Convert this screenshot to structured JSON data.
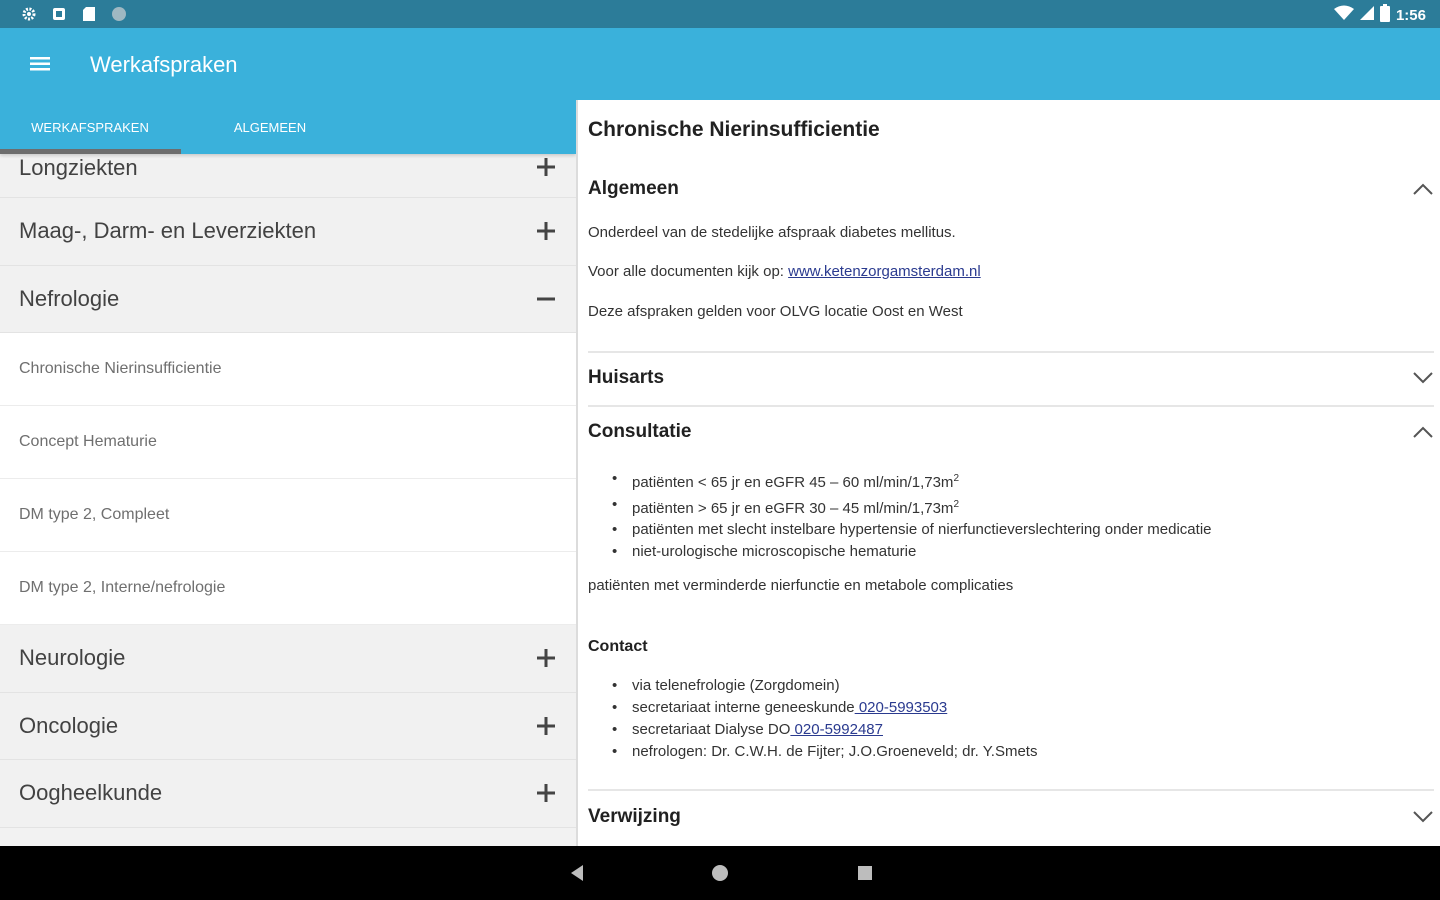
{
  "status_bar": {
    "time": "1:56",
    "left_icons": [
      "settings-icon",
      "notification-icon",
      "sd-card-icon",
      "circle-icon"
    ],
    "right_icons": [
      "wifi-icon",
      "signal-icon",
      "battery-icon"
    ]
  },
  "app_bar": {
    "title": "Werkafspraken",
    "menu_icon": "hamburger-menu-icon",
    "color": "#3ab1db"
  },
  "tabs": [
    {
      "label": "WERKAFSPRAKEN",
      "selected": true
    },
    {
      "label": "ALGEMEEN",
      "selected": false
    }
  ],
  "categories": [
    {
      "label": "Longziekten",
      "expanded": false
    },
    {
      "label": "Maag-, Darm- en Leverziekten",
      "expanded": false
    },
    {
      "label": "Nefrologie",
      "expanded": true,
      "items": [
        "Chronische Nierinsufficientie",
        "Concept Hematurie",
        "DM type 2, Compleet",
        "DM type 2, Interne/nefrologie"
      ]
    },
    {
      "label": "Neurologie",
      "expanded": false
    },
    {
      "label": "Oncologie",
      "expanded": false
    },
    {
      "label": "Oogheelkunde",
      "expanded": false
    }
  ],
  "detail": {
    "title": "Chronische Nierinsufficientie",
    "sections": {
      "algemeen": {
        "title": "Algemeen",
        "expanded": true,
        "line1": "Onderdeel van de stedelijke afspraak diabetes mellitus.",
        "line2_prefix": "Voor alle documenten kijk op: ",
        "line2_link": "www.ketenzorgamsterdam.nl",
        "line3": "Deze afspraken gelden voor OLVG locatie Oost en West"
      },
      "huisarts": {
        "title": "Huisarts",
        "expanded": false
      },
      "consultatie": {
        "title": "Consultatie",
        "expanded": true,
        "bullets": [
          {
            "text": "patiënten < 65 jr en eGFR 45 – 60 ml/min/1,73m",
            "sup": "2"
          },
          {
            "text": "patiënten > 65 jr en eGFR 30 – 45 ml/min/1,73m",
            "sup": "2"
          },
          {
            "text": "patiënten met slecht instelbare hypertensie of nierfunctieverslechtering  onder medicatie",
            "sup": ""
          },
          {
            "text": "niet-urologische microscopische hematurie",
            "sup": ""
          }
        ],
        "note": "patiënten met verminderde nierfunctie en metabole complicaties",
        "contact_title": "Contact",
        "contacts": [
          {
            "text": "via telenefrologie (Zorgdomein)",
            "link": ""
          },
          {
            "text": "secretariaat interne geneeskunde",
            "link": " 020-5993503"
          },
          {
            "text": "secretariaat Dialyse DO",
            "link": " 020-5992487"
          },
          {
            "text": "nefrologen: Dr. C.W.H. de Fijter; J.O.Groeneveld; dr. Y.Smets",
            "link": ""
          }
        ]
      },
      "verwijzing": {
        "title": "Verwijzing",
        "expanded": false
      }
    }
  },
  "nav_bar": {
    "buttons": [
      "back-icon",
      "home-icon",
      "recents-icon"
    ]
  }
}
